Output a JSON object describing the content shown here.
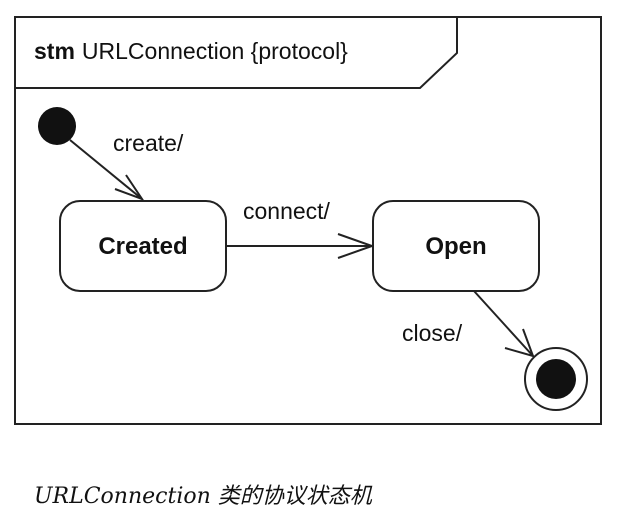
{
  "frame": {
    "keyword": "stm",
    "name": "URLConnection {protocol}"
  },
  "states": [
    {
      "id": "created",
      "label": "Created"
    },
    {
      "id": "open",
      "label": "Open"
    }
  ],
  "transitions": [
    {
      "from": "initial",
      "to": "created",
      "label": "create/"
    },
    {
      "from": "created",
      "to": "open",
      "label": "connect/"
    },
    {
      "from": "open",
      "to": "final",
      "label": "close/"
    }
  ],
  "caption": "URLConnection 类的协议状态机"
}
